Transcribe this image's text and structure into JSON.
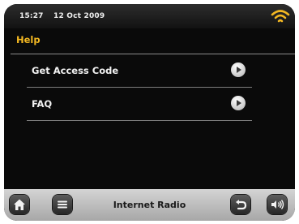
{
  "status": {
    "time": "15:27",
    "date": "12 Oct  2009",
    "wifi_icon": "wifi-icon",
    "accent_color": "#f3b822"
  },
  "screen": {
    "title": "Help"
  },
  "menu": {
    "items": [
      {
        "label": "Get Access Code",
        "icon": "chevron-right-icon"
      },
      {
        "label": "FAQ",
        "icon": "chevron-right-icon"
      }
    ]
  },
  "footer": {
    "title": "Internet Radio",
    "buttons": [
      {
        "icon": "home-icon"
      },
      {
        "icon": "menu-icon"
      },
      {
        "icon": "back-icon"
      },
      {
        "icon": "volume-icon"
      }
    ]
  }
}
